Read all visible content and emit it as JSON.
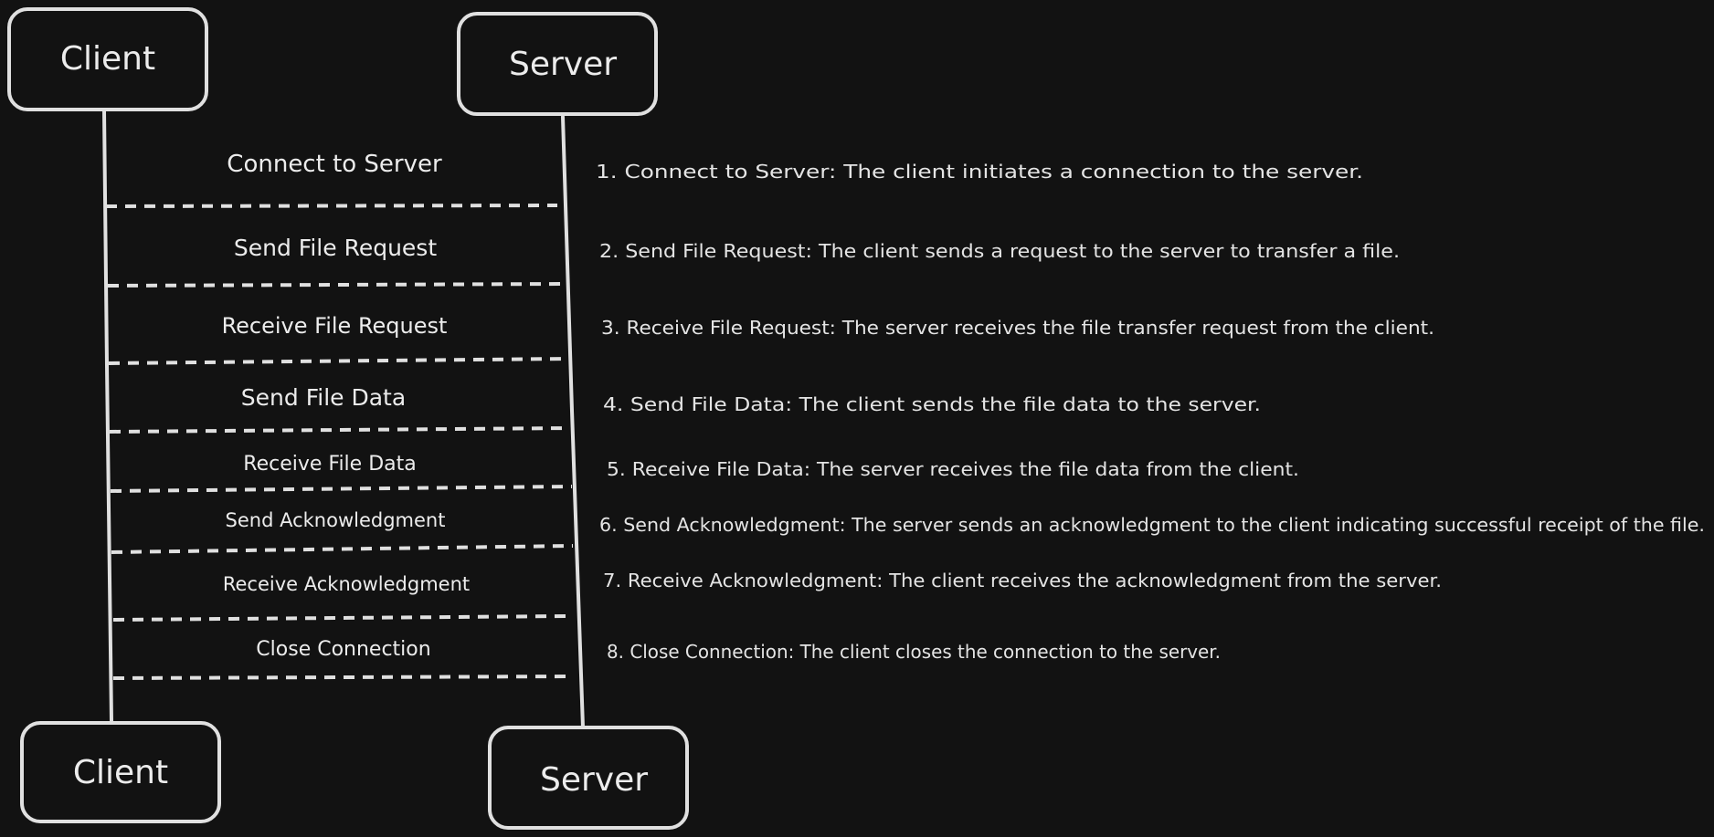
{
  "actors": {
    "client_top": "Client",
    "server_top": "Server",
    "client_bottom": "Client",
    "server_bottom": "Server"
  },
  "messages": [
    {
      "label": "Connect to Server"
    },
    {
      "label": "Send File Request"
    },
    {
      "label": "Receive File Request"
    },
    {
      "label": "Send File Data"
    },
    {
      "label": "Receive File Data"
    },
    {
      "label": "Send Acknowledgment"
    },
    {
      "label": "Receive Acknowledgment"
    },
    {
      "label": "Close Connection"
    }
  ],
  "notes": [
    "1. Connect to Server: The client initiates a connection to the server.",
    "2. Send File Request: The client sends a request to the server to transfer a file.",
    "3. Receive File Request: The server receives the file transfer request from the client.",
    "4. Send File Data: The client sends the file data to the server.",
    "5. Receive File Data: The server receives the file data from the client.",
    "6. Send Acknowledgment: The server sends an acknowledgment to the client indicating successful receipt of the file.",
    "7. Receive Acknowledgment: The client receives the acknowledgment from the server.",
    "8. Close Connection: The client closes the connection to the server."
  ],
  "colors": {
    "background": "#121212",
    "stroke": "#e0e0e0",
    "text": "#ececec"
  }
}
